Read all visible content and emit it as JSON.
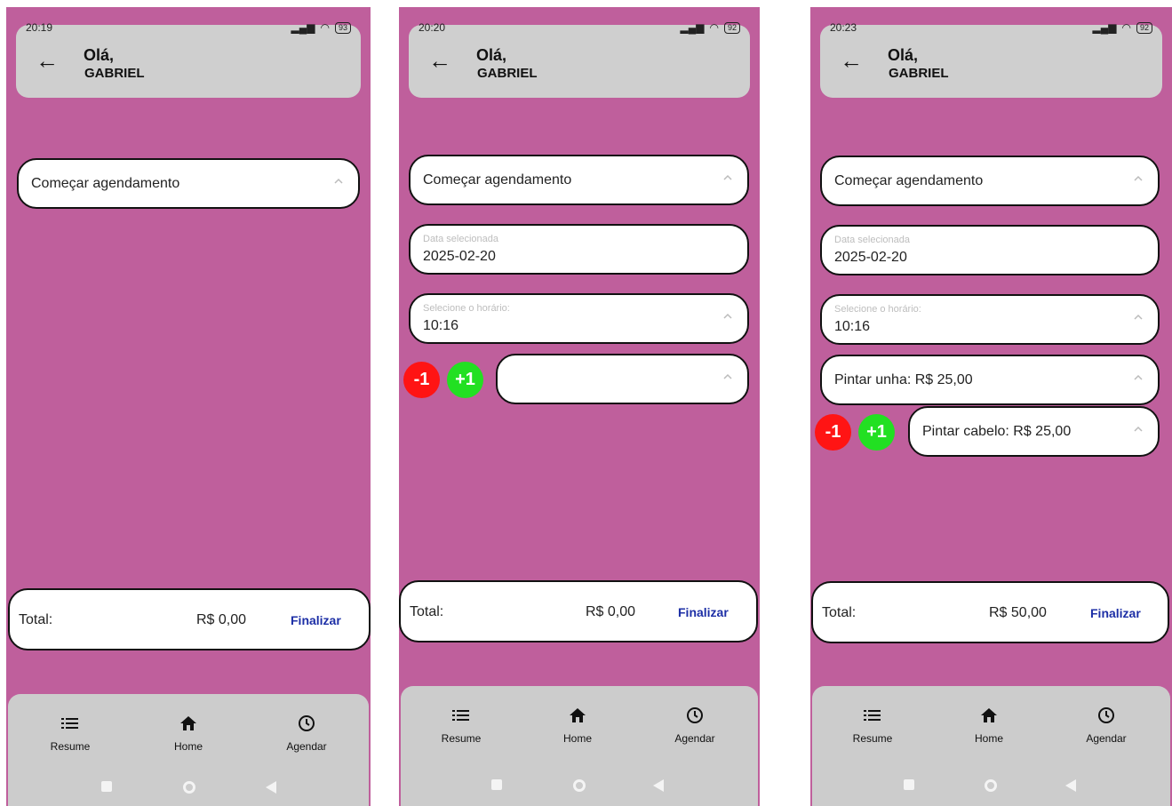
{
  "phones": [
    {
      "status": {
        "time": "20:19",
        "battery": "93"
      },
      "header": {
        "greeting": "Olá,",
        "user": "GABRIEL"
      },
      "start_label": "Começar agendamento",
      "total": {
        "label": "Total:",
        "value": "R$ 0,00",
        "action": "Finalizar"
      }
    },
    {
      "status": {
        "time": "20:20",
        "battery": "92"
      },
      "header": {
        "greeting": "Olá,",
        "user": "GABRIEL"
      },
      "start_label": "Começar agendamento",
      "date_label": "Data selecionada",
      "date_value": "2025-02-20",
      "time_label": "Selecione o horário:",
      "time_value": "10:16",
      "minus": "-1",
      "plus": "+1",
      "service_value": "",
      "total": {
        "label": "Total:",
        "value": "R$ 0,00",
        "action": "Finalizar"
      }
    },
    {
      "status": {
        "time": "20:23",
        "battery": "92"
      },
      "header": {
        "greeting": "Olá,",
        "user": "GABRIEL"
      },
      "start_label": "Começar agendamento",
      "date_label": "Data selecionada",
      "date_value": "2025-02-20",
      "time_label": "Selecione o horário:",
      "time_value": "10:16",
      "service1": "Pintar unha: R$ 25,00",
      "minus": "-1",
      "plus": "+1",
      "service2": "Pintar cabelo: R$ 25,00",
      "total": {
        "label": "Total:",
        "value": "R$ 50,00",
        "action": "Finalizar"
      }
    }
  ],
  "nav": {
    "resume": "Resume",
    "home": "Home",
    "agendar": "Agendar"
  },
  "colors": {
    "background": "#bf5f9c",
    "accent": "#1d2fa6",
    "minus": "#ff1414",
    "plus": "#22e022"
  }
}
